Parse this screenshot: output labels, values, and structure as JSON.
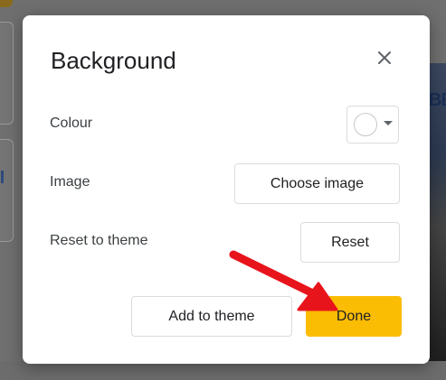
{
  "dialog": {
    "title": "Background",
    "close_icon": "close-icon",
    "rows": {
      "colour_label": "Colour",
      "image_label": "Image",
      "reset_label": "Reset to theme"
    },
    "colour_picker": {
      "selected_color": "#ffffff",
      "caret_icon": "caret-down-icon"
    },
    "buttons": {
      "choose_image": "Choose image",
      "reset": "Reset",
      "add_to_theme": "Add to theme",
      "done": "Done"
    }
  },
  "background": {
    "slide_text": "BE"
  },
  "colors": {
    "accent_done": "#fbbc04",
    "annotation_arrow": "#e8141c",
    "overlay": "#6f6f6f"
  }
}
